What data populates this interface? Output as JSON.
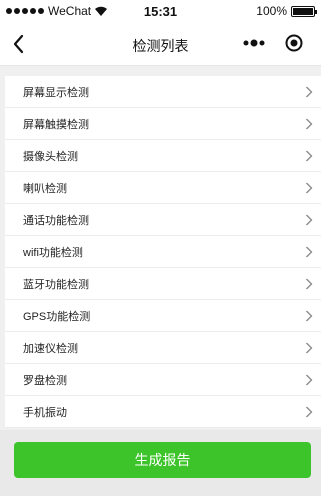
{
  "status_bar": {
    "carrier": "WeChat",
    "time": "15:31",
    "battery": "100%"
  },
  "nav": {
    "title": "检测列表",
    "back_icon": "chevron-left-icon",
    "more_icon": "more-dots-icon",
    "close_icon": "target-icon"
  },
  "list": {
    "items": [
      {
        "label": "屏幕显示检测"
      },
      {
        "label": "屏幕触摸检测"
      },
      {
        "label": "摄像头检测"
      },
      {
        "label": "喇叭检测"
      },
      {
        "label": "通话功能检测"
      },
      {
        "label": "wifi功能检测"
      },
      {
        "label": "蓝牙功能检测"
      },
      {
        "label": "GPS功能检测"
      },
      {
        "label": "加速仪检测"
      },
      {
        "label": "罗盘检测"
      },
      {
        "label": "手机振动"
      }
    ]
  },
  "footer": {
    "button_label": "生成报告",
    "button_color": "#3cc42a"
  }
}
